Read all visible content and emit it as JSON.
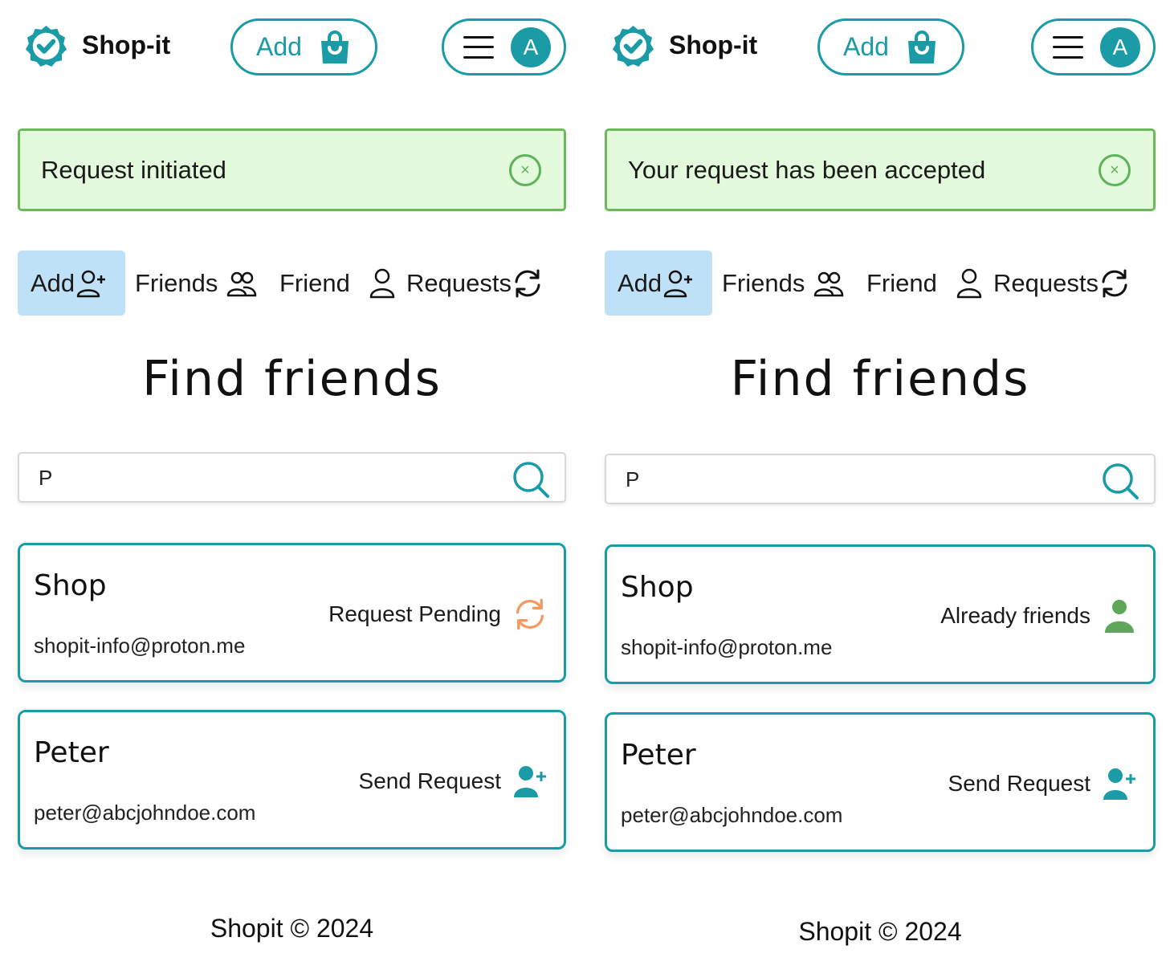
{
  "brand": {
    "name": "Shop-it"
  },
  "colors": {
    "accent": "#1a9ba6",
    "success_bg": "#e3fbdc",
    "success_border": "#6cb95c",
    "active_tab": "#bfe1f8",
    "pending": "#f39a64",
    "friend": "#5ea65a"
  },
  "panels": [
    {
      "header": {
        "add_label": "Add",
        "avatar_letter": "A"
      },
      "alert": {
        "message": "Request initiated",
        "close_glyph": "×"
      },
      "tabs": [
        {
          "label": "Add",
          "icon": "user-plus-icon",
          "active": true
        },
        {
          "label": "Friends",
          "icon": "users-icon"
        },
        {
          "label": "Friend",
          "icon": "user-icon"
        },
        {
          "label": "Requests",
          "icon": "refresh-icon"
        }
      ],
      "title": "Find friends",
      "search": {
        "value": "P"
      },
      "results": [
        {
          "name": "Shop",
          "email": "shopit-info@proton.me",
          "action": "Request Pending",
          "action_icon": "refresh-icon"
        },
        {
          "name": "Peter",
          "email": "peter@abcjohndoe.com",
          "action": "Send Request",
          "action_icon": "user-plus-icon"
        }
      ],
      "footer": "Shopit © 2024"
    },
    {
      "header": {
        "add_label": "Add",
        "avatar_letter": "A"
      },
      "alert": {
        "message": "Your request has been accepted",
        "close_glyph": "×"
      },
      "tabs": [
        {
          "label": "Add",
          "icon": "user-plus-icon",
          "active": true
        },
        {
          "label": "Friends",
          "icon": "users-icon"
        },
        {
          "label": "Friend",
          "icon": "user-icon"
        },
        {
          "label": "Requests",
          "icon": "refresh-icon"
        }
      ],
      "title": "Find friends",
      "search": {
        "value": "P"
      },
      "results": [
        {
          "name": "Shop",
          "email": "shopit-info@proton.me",
          "action": "Already friends",
          "action_icon": "user-icon"
        },
        {
          "name": "Peter",
          "email": "peter@abcjohndoe.com",
          "action": "Send Request",
          "action_icon": "user-plus-icon"
        }
      ],
      "footer": "Shopit © 2024"
    }
  ]
}
